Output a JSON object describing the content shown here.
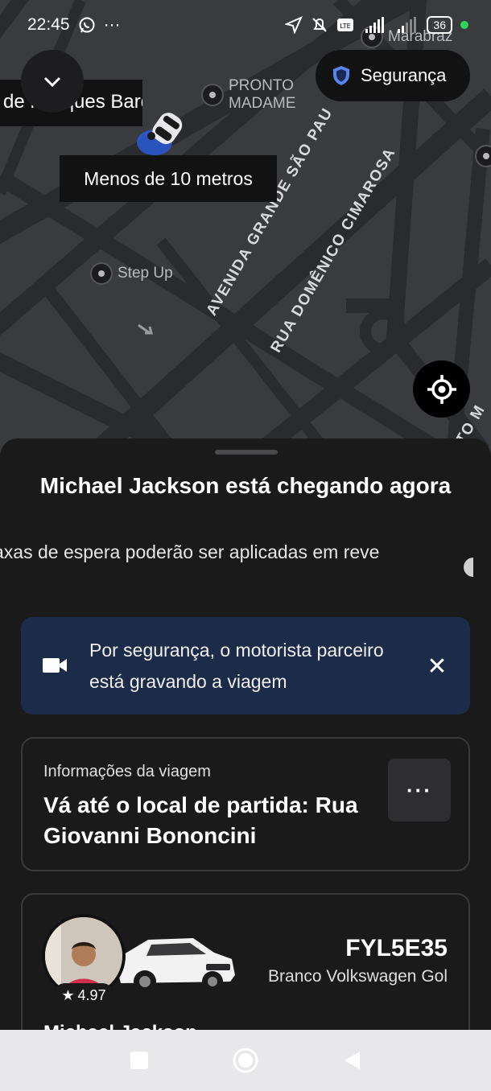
{
  "status": {
    "time": "22:45",
    "ellipsis": "···",
    "battery": "36"
  },
  "map": {
    "street_chip": "de Marques Barque",
    "safety_button": "Segurança",
    "distance": "Menos de 10 metros",
    "pois": {
      "pronto_madame_line1": "PRONTO",
      "pronto_madame_line2": "MADAME",
      "marabraz": "Marabraz",
      "step_up": "Step Up"
    },
    "streets": {
      "avenida": "AVENIDA GRANDE SÃO PAU",
      "rua": "RUA DOMÊNICO CIMAROSA",
      "right_edge": "TO M"
    }
  },
  "sheet": {
    "title": "Michael Jackson está chegando agora",
    "wait_notice": "axas de espera poderão ser aplicadas em reve",
    "banner": {
      "text": "Por segurança, o motorista parceiro está gravando a viagem",
      "close_symbol": "✕"
    },
    "trip": {
      "label": "Informações da viagem",
      "destination": "Vá até o local de partida: Rua Giovanni Bononcini",
      "more": "···"
    },
    "driver": {
      "rating": "4.97",
      "plate": "FYL5E35",
      "car": "Branco Volkswagen Gol",
      "name": "Michael Jackson"
    }
  },
  "icons": {
    "whatsapp": "whatsapp-icon",
    "location": "location-arrow-icon",
    "mute": "bell-off-icon",
    "shield": "shield-icon",
    "locate": "crosshair-icon",
    "camera": "video-camera-icon",
    "star": "star-icon"
  },
  "colors": {
    "banner_bg": "#1c2c48",
    "map_bg": "#3a3b3f",
    "sheet_bg": "#1a1a1a",
    "car_marker": "#2a5bd7"
  }
}
